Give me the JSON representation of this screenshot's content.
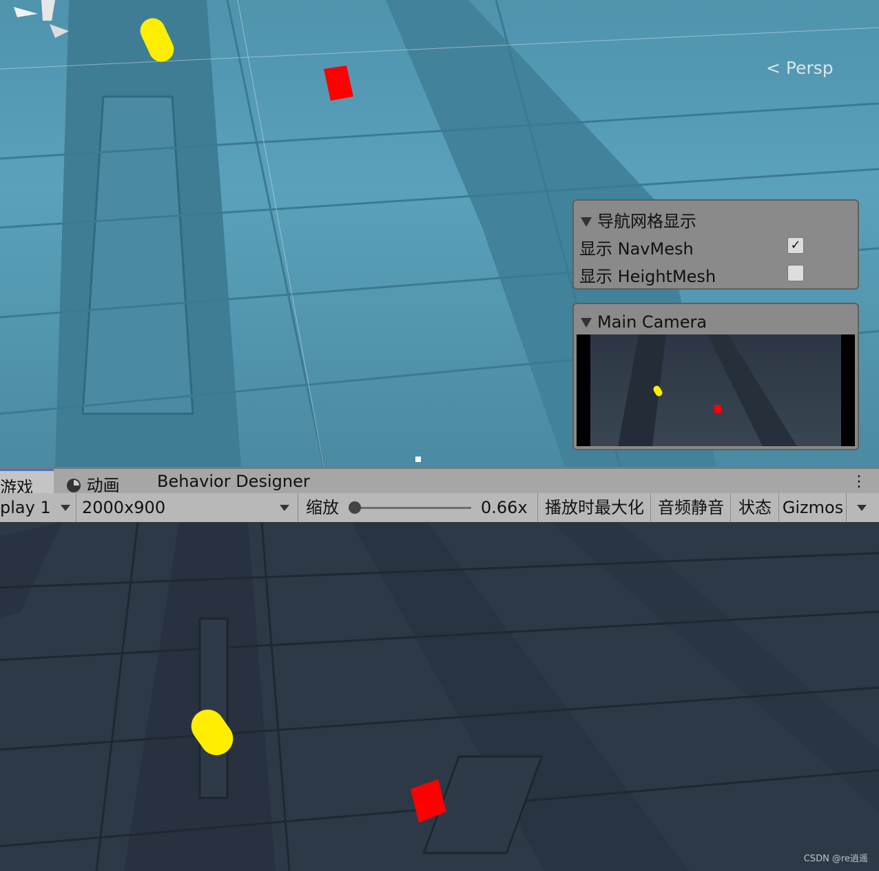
{
  "scene_view": {
    "persp_label": "Persp",
    "colors": {
      "floor": "#5aa1bb",
      "capsule": "#ffee00",
      "cube": "#ff0000"
    }
  },
  "navmesh_overlay": {
    "title": "导航网格显示",
    "rows": [
      {
        "label": "显示 NavMesh",
        "checked": true
      },
      {
        "label": "显示 HeightMesh",
        "checked": false
      }
    ]
  },
  "camera_overlay": {
    "title": "Main Camera"
  },
  "tabs": [
    {
      "label": "游戏",
      "icon": "game-icon",
      "active": true
    },
    {
      "label": "动画",
      "icon": "clock-icon",
      "active": false
    },
    {
      "label": "Behavior Designer",
      "active": false
    }
  ],
  "toolbar": {
    "display": "play 1",
    "resolution": "2000x900",
    "scale_label": "缩放",
    "scale_value": "0.66x",
    "maximize": "播放时最大化",
    "mute": "音频静音",
    "stats": "状态",
    "gizmos": "Gizmos"
  },
  "watermark": "CSDN @re逍遥"
}
